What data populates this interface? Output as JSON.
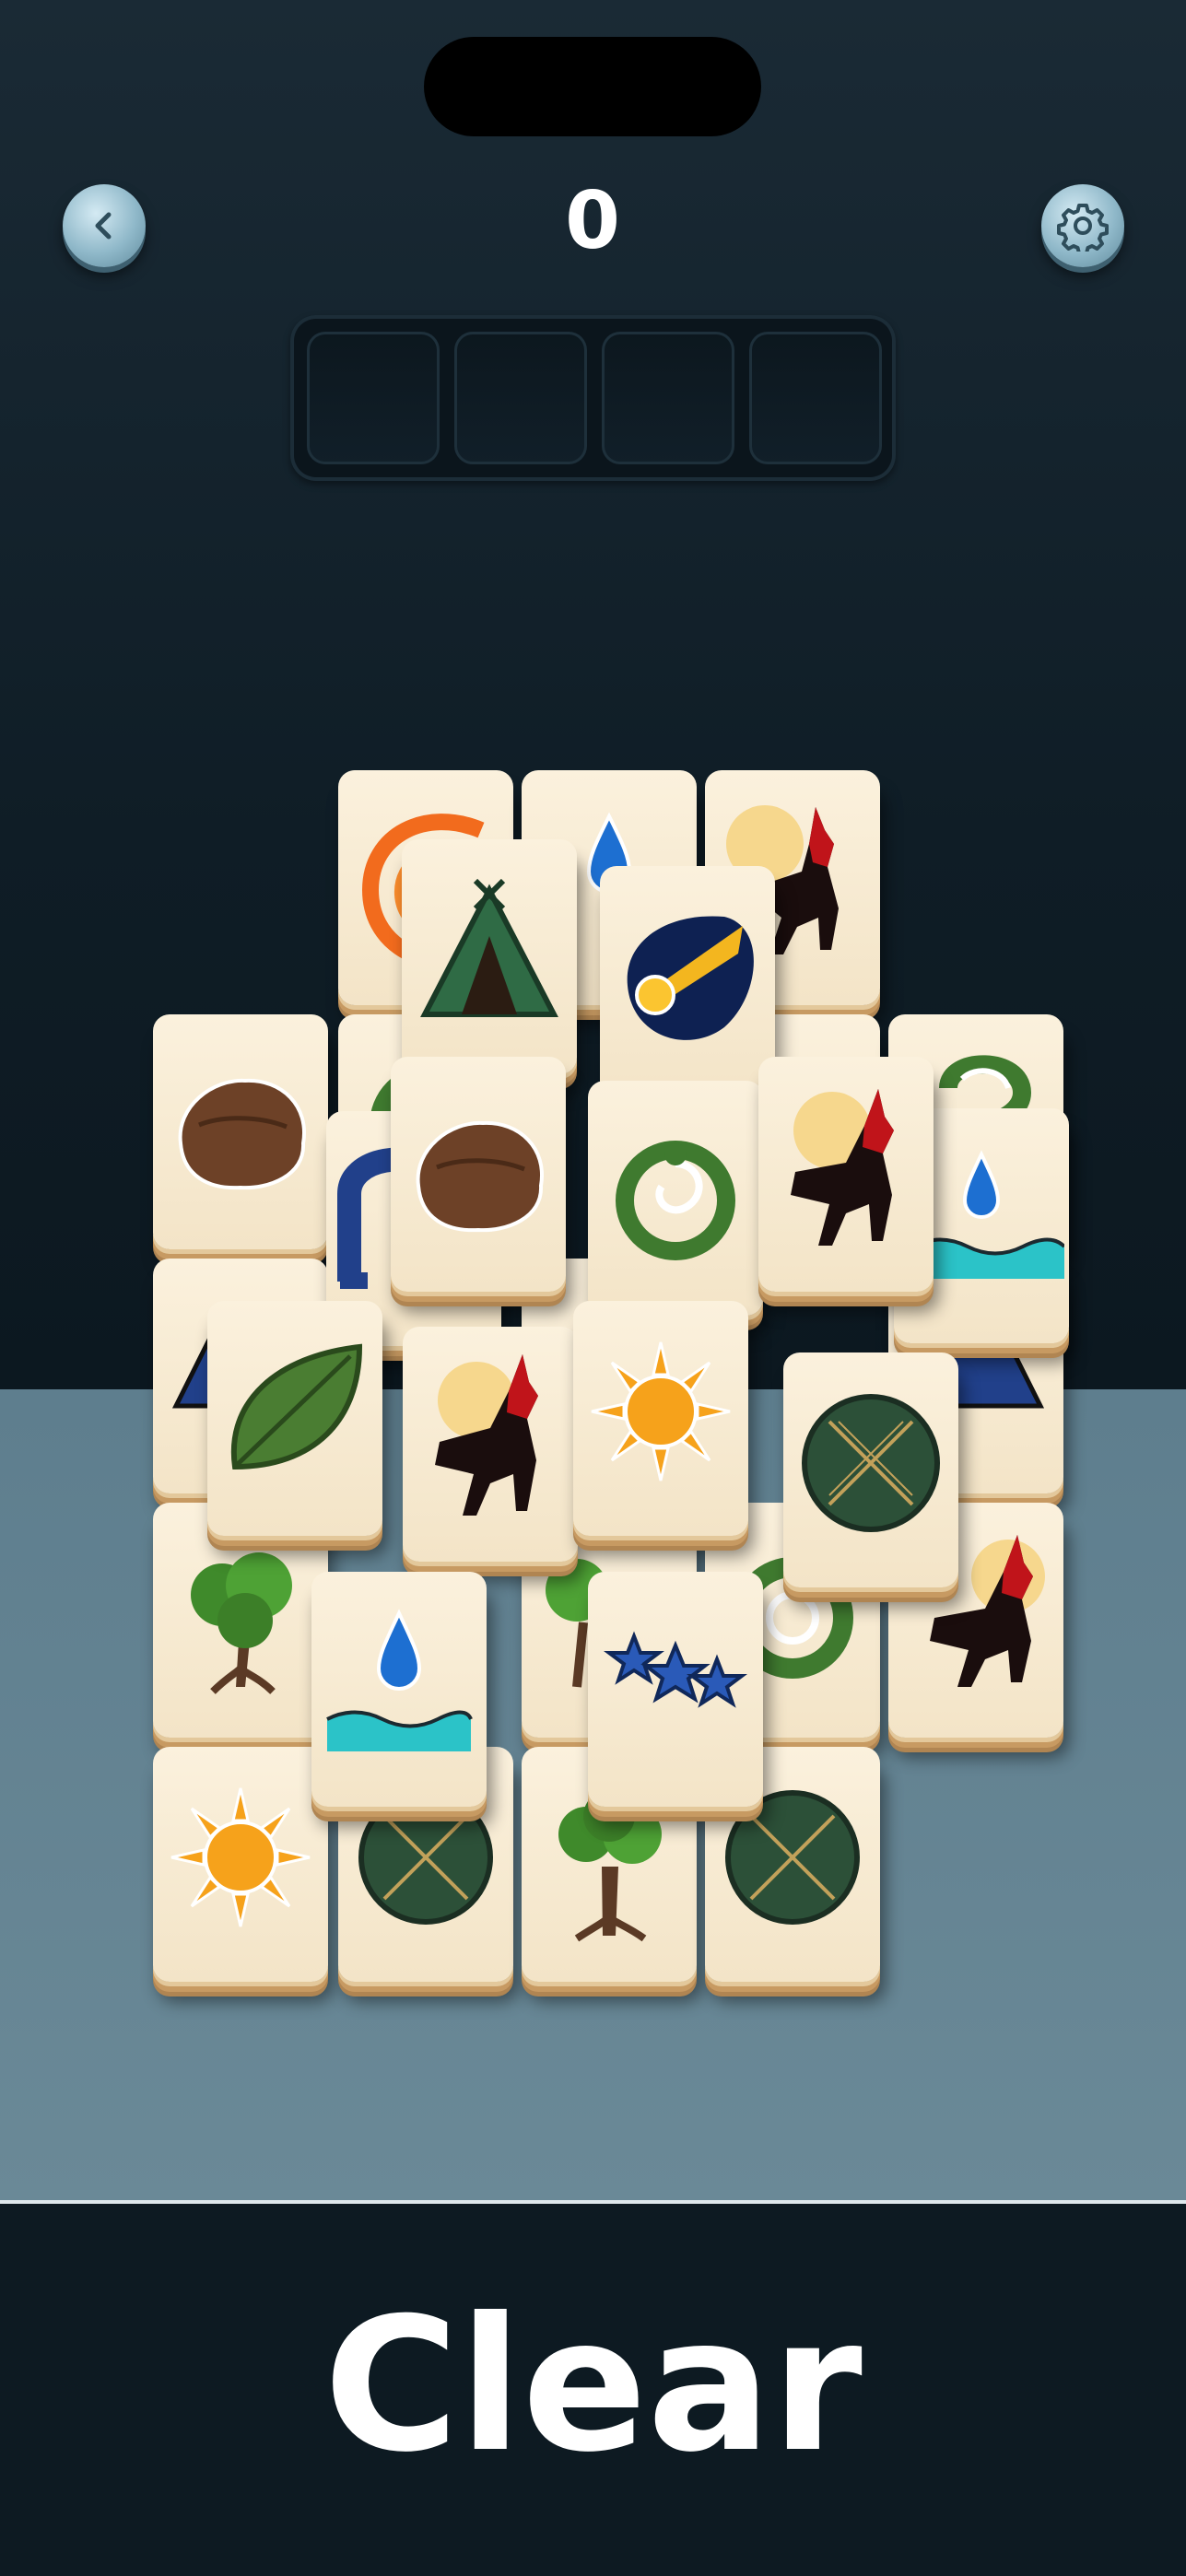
{
  "header": {
    "score": "0",
    "back_icon": "chevron-left-icon",
    "settings_icon": "gear-icon"
  },
  "tray": {
    "slot_count": 4
  },
  "board": {
    "tile_symbols": [
      "fire",
      "water-drop",
      "wolf-moon",
      "tent",
      "comet",
      "rock",
      "snake",
      "water-wave",
      "temple",
      "leaf",
      "sun",
      "shield",
      "tree",
      "stars"
    ]
  },
  "footer": {
    "title": "Clear"
  },
  "colors": {
    "background": "#0f1d26",
    "table": "#6a8997",
    "tile_face": "#f6e8cd",
    "tile_edge": "#c79a62",
    "button": "#8fb8c9"
  }
}
